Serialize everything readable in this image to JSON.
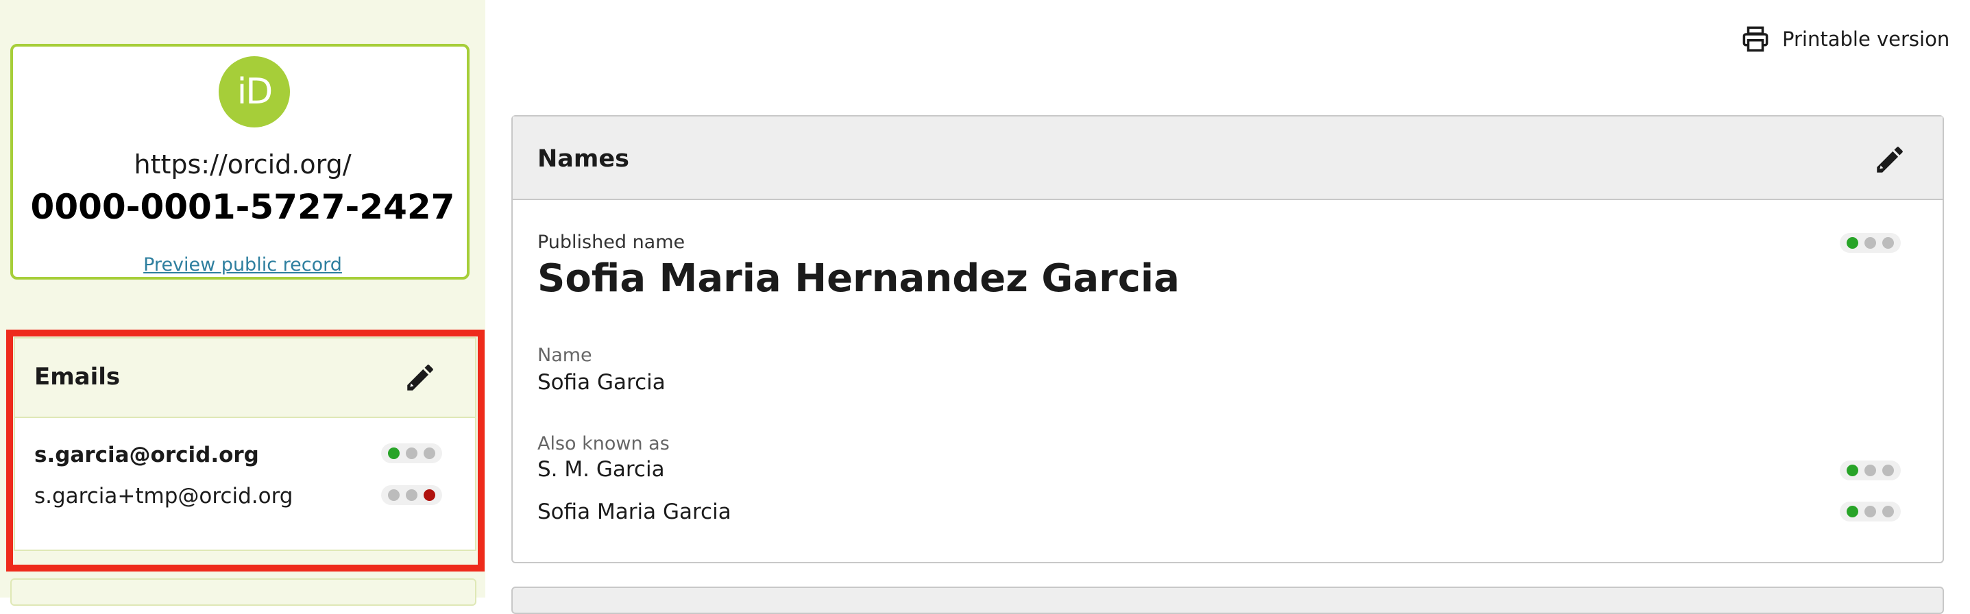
{
  "sidebar": {
    "logo_text": "iD",
    "orcid_prefix": "https://orcid.org/",
    "orcid_id": "0000-0001-5727-2427",
    "preview_link": "Preview public record",
    "emails": {
      "title": "Emails",
      "edit_icon": "pencil-icon",
      "items": [
        {
          "address": "s.garcia@orcid.org",
          "primary": true,
          "visibility": "everyone"
        },
        {
          "address": "s.garcia+tmp@orcid.org",
          "primary": false,
          "visibility": "only-me"
        }
      ]
    }
  },
  "header": {
    "printable_label": "Printable version",
    "printable_icon": "printer-icon"
  },
  "names": {
    "title": "Names",
    "edit_icon": "pencil-icon",
    "published_name_label": "Published name",
    "published_name": "Sofia Maria Hernandez Garcia",
    "published_visibility": "everyone",
    "name_label": "Name",
    "name_value": "Sofia Garcia",
    "aka_label": "Also known as",
    "aka": [
      {
        "value": "S. M. Garcia",
        "visibility": "everyone"
      },
      {
        "value": "Sofia Maria Garcia",
        "visibility": "everyone"
      }
    ]
  },
  "colors": {
    "orcid_green": "#a6ce39",
    "sidebar_bg": "#f5f8e6",
    "highlight_red": "#ee2b1b",
    "visibility_green": "#28a428",
    "visibility_red": "#b0120e",
    "link_teal": "#2e7f9f"
  }
}
